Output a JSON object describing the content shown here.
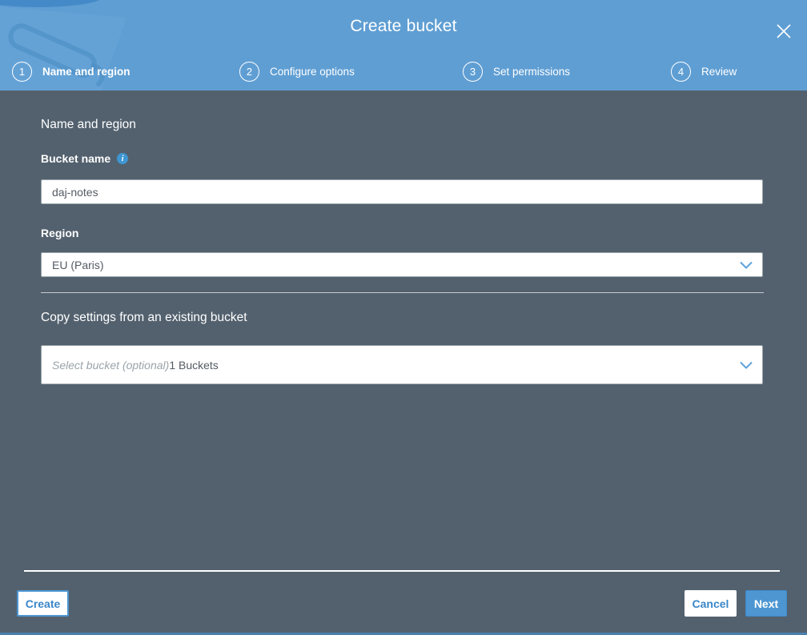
{
  "modal": {
    "title": "Create bucket",
    "close_icon": "x-icon"
  },
  "steps": [
    {
      "number": "1",
      "label": "Name and region",
      "active": true
    },
    {
      "number": "2",
      "label": "Configure options",
      "active": false
    },
    {
      "number": "3",
      "label": "Set permissions",
      "active": false
    },
    {
      "number": "4",
      "label": "Review",
      "active": false
    }
  ],
  "form": {
    "section_heading": "Name and region",
    "bucket_name": {
      "label": "Bucket name",
      "info_icon": "info-icon",
      "value": "daj-notes"
    },
    "region": {
      "label": "Region",
      "selected": "EU (Paris)"
    },
    "copy_settings": {
      "heading": "Copy settings from an existing bucket",
      "placeholder": "Select bucket (optional)",
      "suffix": "1 Buckets"
    }
  },
  "footer": {
    "create_label": "Create",
    "cancel_label": "Cancel",
    "next_label": "Next"
  },
  "colors": {
    "header_blue": "#5f9ed3",
    "body_gray": "#53616e",
    "accent_blue": "#3a87c8",
    "next_button_blue": "#4d96d2",
    "info_icon_blue": "#3e96d2"
  }
}
